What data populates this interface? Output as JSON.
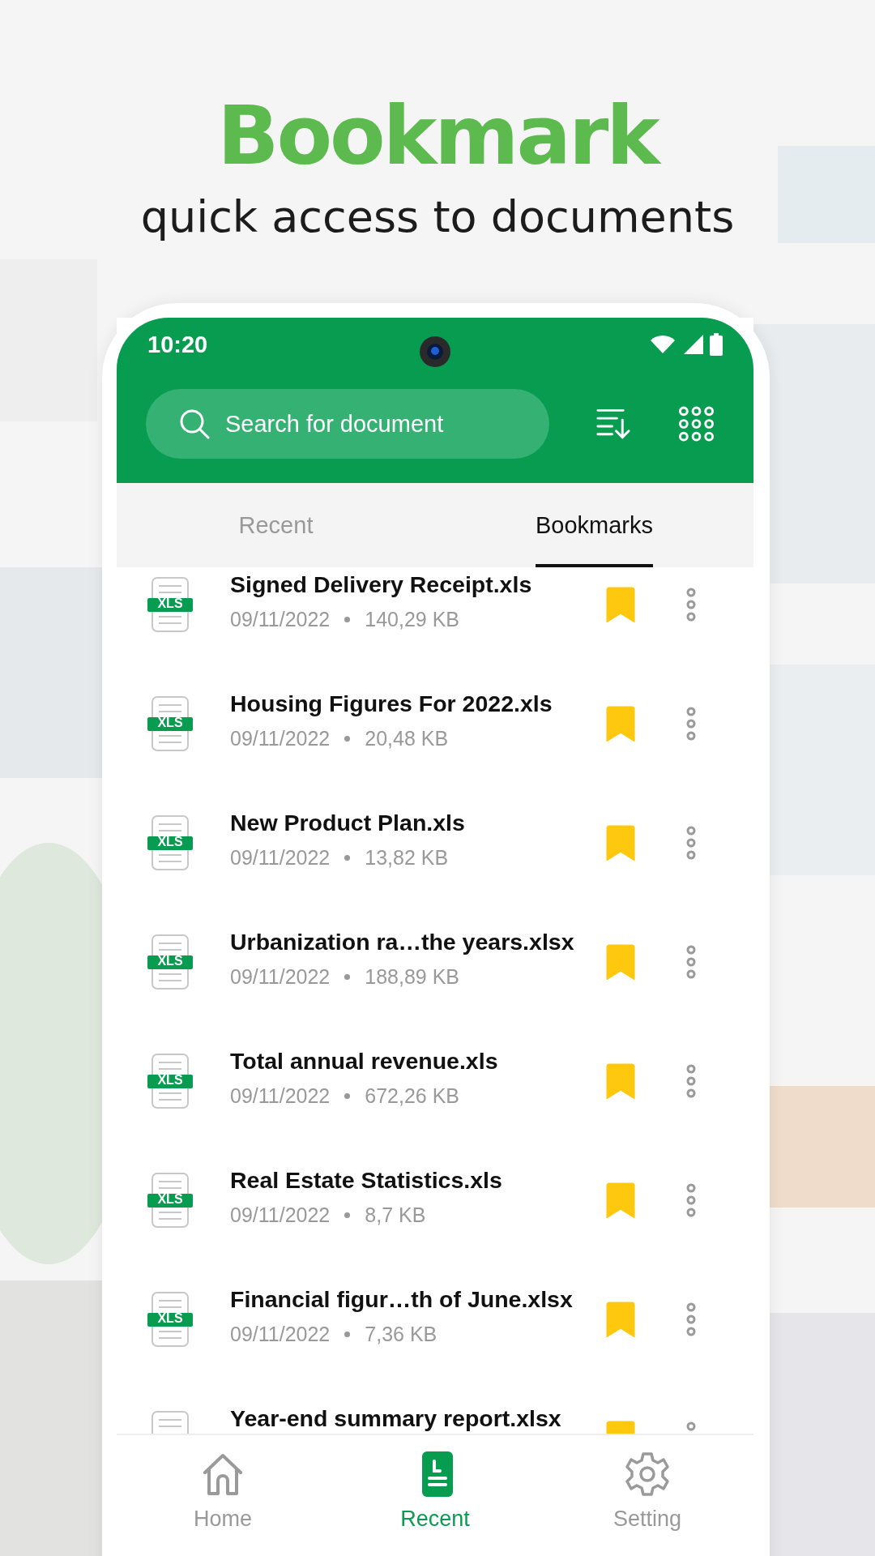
{
  "headline": {
    "title": "Bookmark",
    "subtitle": "quick access to documents"
  },
  "status_bar": {
    "time": "10:20"
  },
  "search": {
    "placeholder": "Search for document"
  },
  "tabs": [
    {
      "label": "Recent",
      "selected": false
    },
    {
      "label": "Bookmarks",
      "selected": true
    }
  ],
  "files": [
    {
      "name": "Signed Delivery Receipt.xls",
      "badge": "XLS",
      "date": "09/11/2022",
      "size": "140,29 KB",
      "bookmarked": true
    },
    {
      "name": "Housing Figures For 2022.xls",
      "badge": "XLS",
      "date": "09/11/2022",
      "size": "20,48 KB",
      "bookmarked": true
    },
    {
      "name": "New Product Plan.xls",
      "badge": "XLS",
      "date": "09/11/2022",
      "size": "13,82 KB",
      "bookmarked": true
    },
    {
      "name": "Urbanization ra…the years.xlsx",
      "badge": "XLS",
      "date": "09/11/2022",
      "size": "188,89 KB",
      "bookmarked": true
    },
    {
      "name": "Total annual revenue.xls",
      "badge": "XLS",
      "date": "09/11/2022",
      "size": "672,26 KB",
      "bookmarked": true
    },
    {
      "name": "Real Estate Statistics.xls",
      "badge": "XLS",
      "date": "09/11/2022",
      "size": "8,7 KB",
      "bookmarked": true
    },
    {
      "name": "Financial figur…th of June.xlsx",
      "badge": "XLS",
      "date": "09/11/2022",
      "size": "7,36 KB",
      "bookmarked": true
    },
    {
      "name": "Year-end summary report.xlsx",
      "bookmarked": true
    }
  ],
  "nav": [
    {
      "label": "Home",
      "kind": "home",
      "selected": false
    },
    {
      "label": "Recent",
      "kind": "recent",
      "selected": true
    },
    {
      "label": "Setting",
      "kind": "settings",
      "selected": false
    }
  ]
}
